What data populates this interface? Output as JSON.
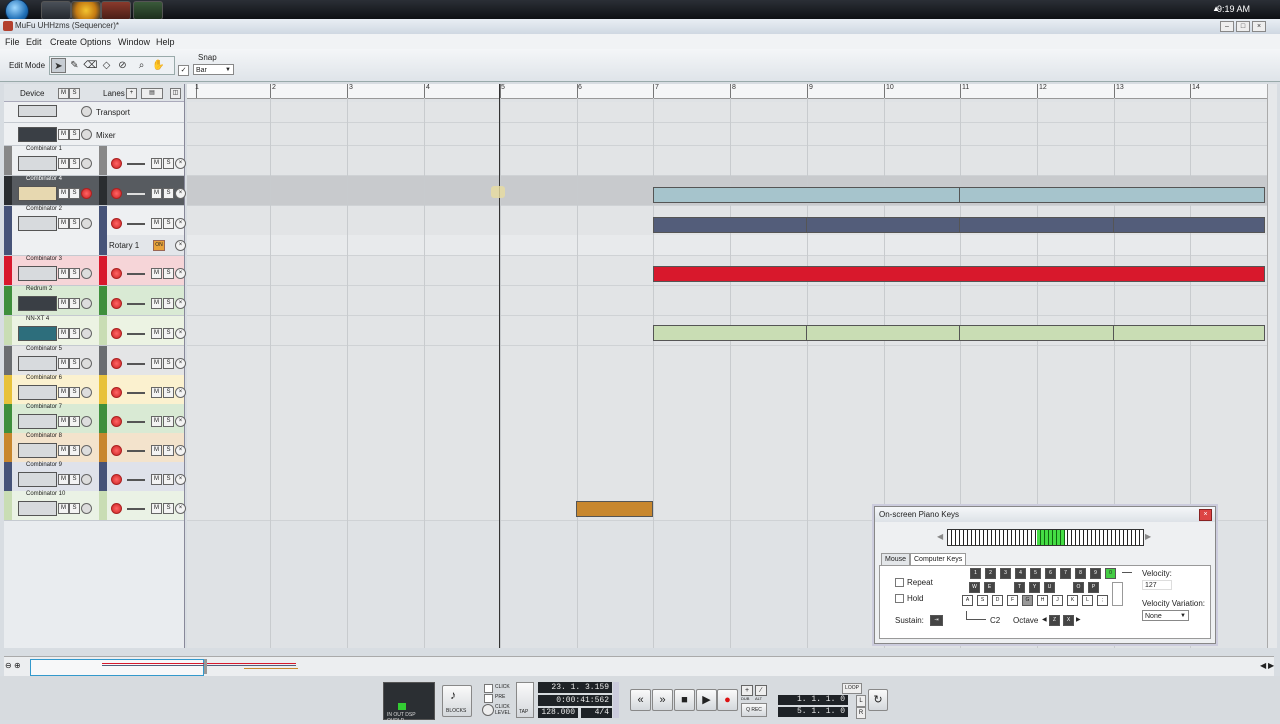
{
  "taskbar": {
    "clock": "9:19 AM"
  },
  "window": {
    "title": "MuFu UHHzms (Sequencer)*"
  },
  "menu": [
    "File",
    "Edit",
    "Create",
    "Options",
    "Window",
    "Help"
  ],
  "toolbar": {
    "edit_mode_label": "Edit Mode",
    "snap_label": "Snap",
    "snap_value": "Bar",
    "snap_enabled": true
  },
  "trackheader": {
    "device_label": "Device",
    "lanes_label": "Lanes"
  },
  "tracks": {
    "transport": "Transport",
    "mixer": "Mixer",
    "combinator1": "Combinator 1",
    "combinator4": "Combinator 4",
    "combinator2": "Combinator 2",
    "rotary": "Rotary 1",
    "rotary_badge": "ON",
    "combinator3": "Combinator 3",
    "redrum2": "Redrum 2",
    "nnxt4": "NN-XT 4",
    "combinator5": "Combinator 5",
    "combinator6": "Combinator 6",
    "combinator7": "Combinator 7",
    "combinator8": "Combinator 8",
    "combinator9": "Combinator 9",
    "combinator10": "Combinator 10"
  },
  "ruler": [
    "1",
    "2",
    "3",
    "4",
    "5",
    "6",
    "7",
    "8",
    "9",
    "10",
    "11",
    "12",
    "13",
    "14"
  ],
  "colors": {
    "combi4_clip": "#a6c4cc",
    "combi2_clip": "#535d7a",
    "combi3_clip": "#d8182c",
    "nnxt_clip": "#c9ddb4",
    "combi10_clip": "#c8872e",
    "red": "#d8182c",
    "yellow": "#e8c23a",
    "green": "#3f8f3c",
    "orange": "#c8872e",
    "navy": "#465378",
    "gray": "#6a6d70"
  },
  "piano": {
    "title": "On-screen Piano Keys",
    "tab_mouse": "Mouse",
    "tab_keys": "Computer Keys",
    "repeat_label": "Repeat",
    "hold_label": "Hold",
    "sustain_label": "Sustain:",
    "note": "C2",
    "octave_label": "Octave",
    "octave_down": "Z",
    "octave_up": "X",
    "velocity_label": "Velocity:",
    "velocity_value": "127",
    "velocity_variation_label": "Velocity Variation:",
    "velocity_variation_value": "None",
    "top_keys": [
      "1",
      "2",
      "3",
      "4",
      "5",
      "6",
      "7",
      "8",
      "9",
      "0"
    ],
    "black_keys": [
      "W",
      "E",
      "T",
      "Y",
      "U",
      "O",
      "P"
    ],
    "white_keys": [
      "A",
      "S",
      "D",
      "F",
      "G",
      "H",
      "J",
      "K",
      "L",
      ";"
    ]
  },
  "transport": {
    "blocks_label": "BLOCKS",
    "click_label": "CLICK",
    "pre_label": "PRE",
    "click_level_label": "CLICK LEVEL",
    "tap_label": "TAP",
    "in_out_label": "IN OUT DSP OVRLD",
    "position": "23. 1. 3.159",
    "time": "0:00:41:562",
    "tempo": "128.000",
    "signature": "4/4",
    "dub_label": "DUB",
    "alt_label": "ALT",
    "qrec_label": "Q REC",
    "loop_label": "LOOP",
    "left_locator": "1. 1. 1. 0",
    "right_locator": "5. 1. 1. 0",
    "l_label": "L",
    "r_label": "R"
  }
}
